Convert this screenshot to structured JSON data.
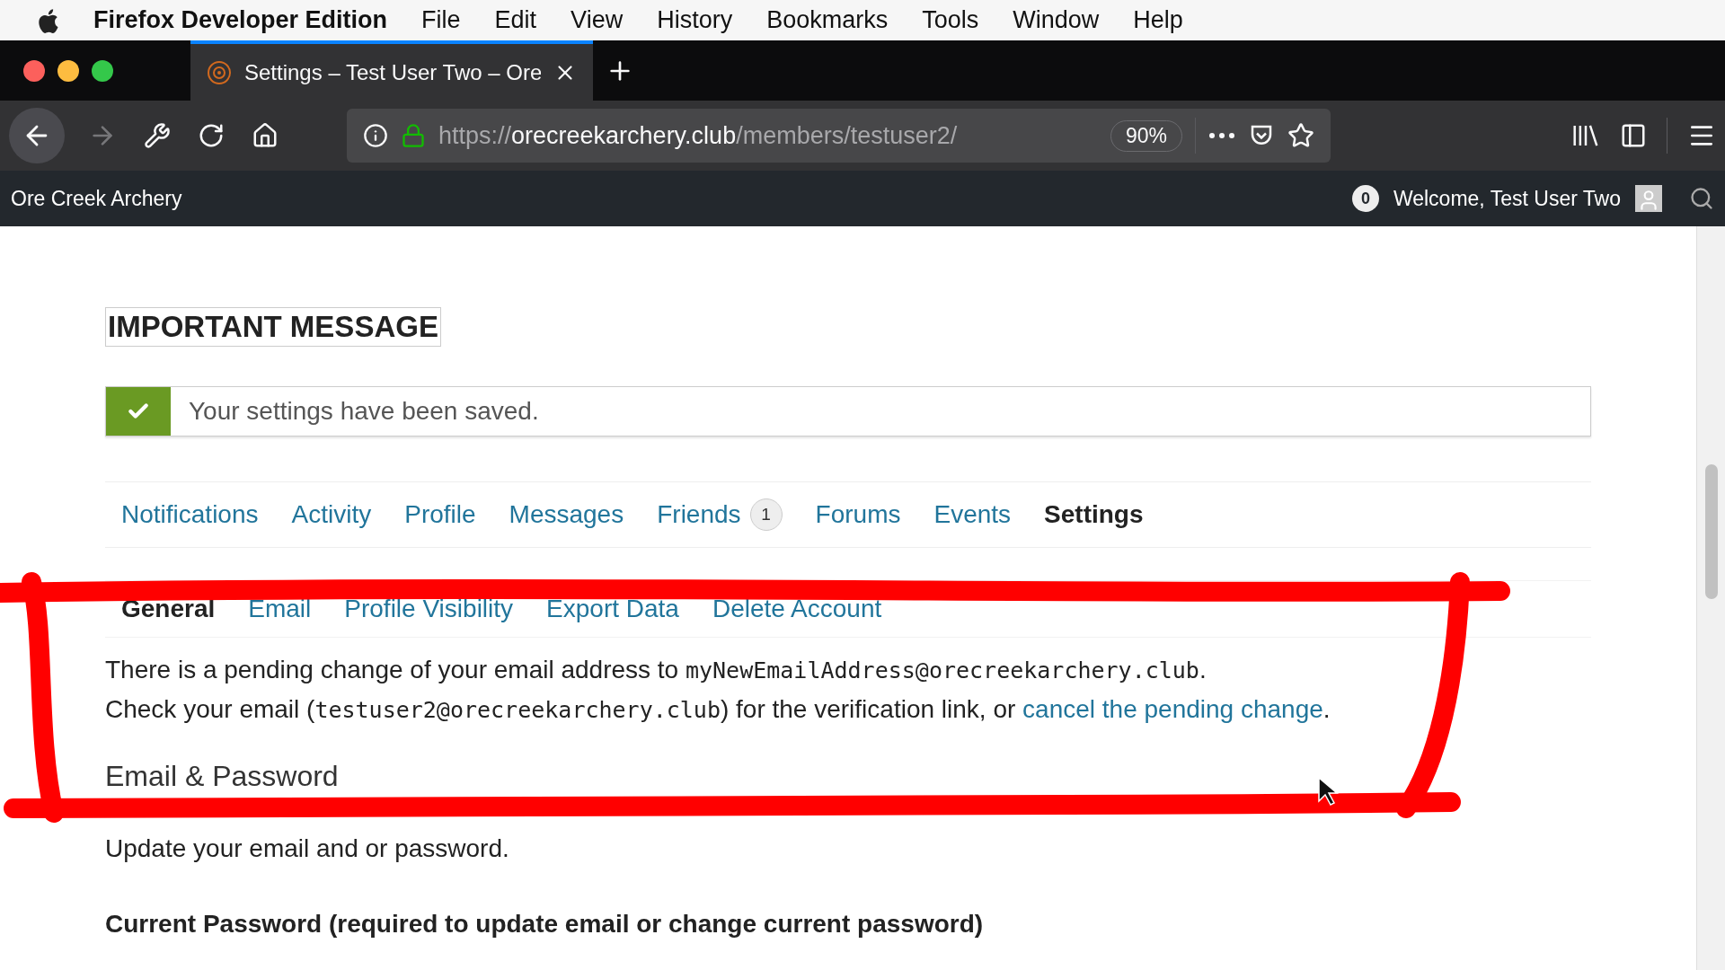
{
  "menubar": {
    "app": "Firefox Developer Edition",
    "items": [
      "File",
      "Edit",
      "View",
      "History",
      "Bookmarks",
      "Tools",
      "Window",
      "Help"
    ]
  },
  "browser": {
    "tabs": [
      {
        "title": "Settings – Test User Two – Ore",
        "selected": true
      }
    ],
    "url": {
      "scheme": "https://",
      "domain": "orecreekarchery.club",
      "path": "/members/testuser2/"
    },
    "zoom": "90%"
  },
  "site_bar": {
    "title": "Ore Creek Archery",
    "notifications": "0",
    "welcome": "Welcome, Test User Two"
  },
  "page": {
    "heading": "IMPORTANT MESSAGE",
    "notice": "Your settings have been saved.",
    "nav": [
      {
        "label": "Notifications",
        "selected": false
      },
      {
        "label": "Activity",
        "selected": false
      },
      {
        "label": "Profile",
        "selected": false
      },
      {
        "label": "Messages",
        "selected": false
      },
      {
        "label": "Friends",
        "selected": false,
        "count": "1"
      },
      {
        "label": "Forums",
        "selected": false
      },
      {
        "label": "Events",
        "selected": false
      },
      {
        "label": "Settings",
        "selected": true
      }
    ],
    "subnav": [
      {
        "label": "General",
        "selected": true
      },
      {
        "label": "Email",
        "selected": false
      },
      {
        "label": "Profile Visibility",
        "selected": false
      },
      {
        "label": "Export Data",
        "selected": false
      },
      {
        "label": "Delete Account",
        "selected": false
      }
    ],
    "pending": [
      [
        {
          "kind": "text",
          "text": "There is a pending change of your email address to "
        },
        {
          "kind": "code",
          "text": "myNewEmailAddress@orecreekarchery.club"
        },
        {
          "kind": "text",
          "text": "."
        }
      ],
      [
        {
          "kind": "text",
          "text": "Check your email ("
        },
        {
          "kind": "code",
          "text": "testuser2@orecreekarchery.club"
        },
        {
          "kind": "text",
          "text": ") for the verification link, or "
        },
        {
          "kind": "link",
          "text": "cancel the pending change"
        },
        {
          "kind": "text",
          "text": "."
        }
      ]
    ],
    "section_title": "Email & Password",
    "section_text": "Update your email and or password.",
    "field_label": "Current Password (required to update email or change current password)"
  }
}
